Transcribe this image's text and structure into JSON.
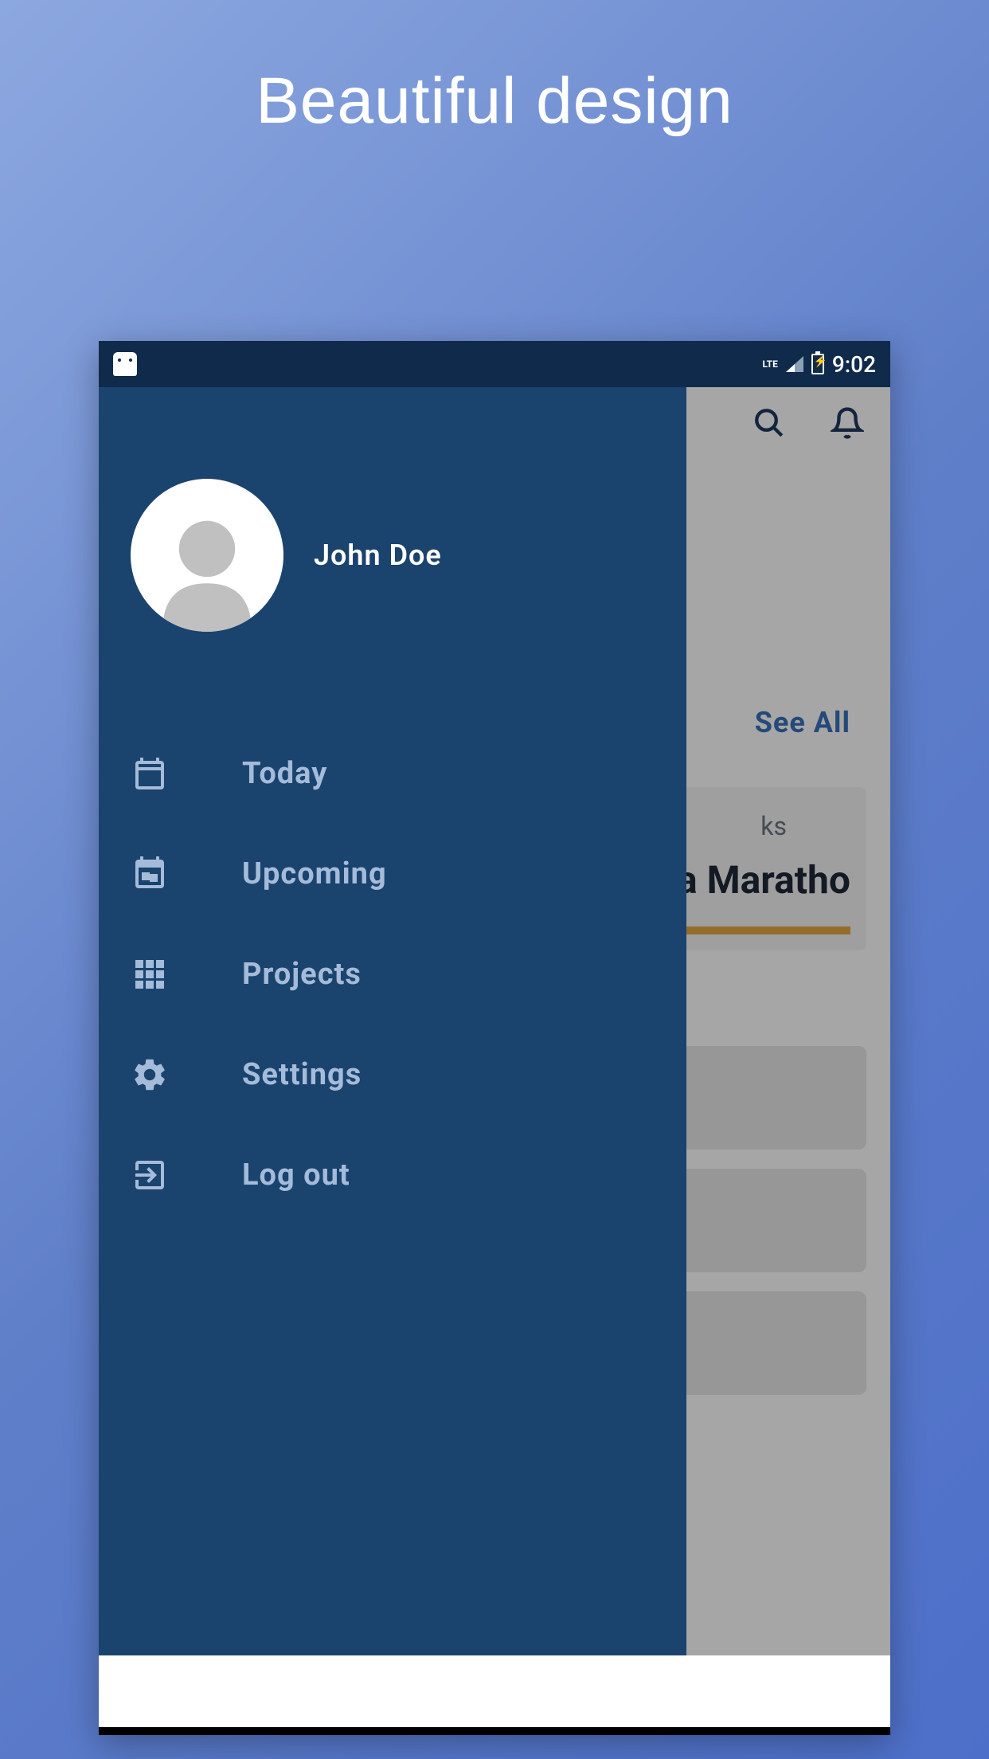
{
  "promo": {
    "title": "Beautiful design"
  },
  "statusBar": {
    "lte": "LTE",
    "time": "9:02"
  },
  "sidebar": {
    "username": "John Doe",
    "items": [
      {
        "label": "Today"
      },
      {
        "label": "Upcoming"
      },
      {
        "label": "Projects"
      },
      {
        "label": "Settings"
      },
      {
        "label": "Log out"
      }
    ]
  },
  "main": {
    "seeAll": "See All",
    "card": {
      "subtitle": "ks",
      "title": "a Maratho"
    }
  }
}
